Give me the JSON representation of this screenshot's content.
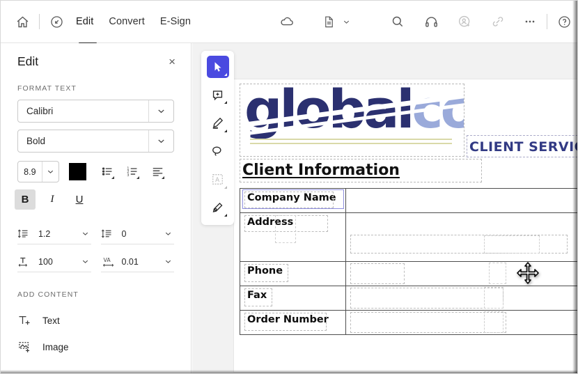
{
  "toolbar": {
    "home_icon": "home-icon",
    "pointer_circle_icon": "annotate-circle-icon",
    "menus": [
      {
        "label": "Edit",
        "active": true
      },
      {
        "label": "Convert",
        "active": false
      },
      {
        "label": "E-Sign",
        "active": false
      }
    ],
    "cloud_icon": "cloud-icon",
    "document_icon": "document-icon",
    "document_chevron_icon": "chevron-down-icon",
    "search_icon": "search-icon",
    "headphones_icon": "headphones-icon",
    "add_person_icon": "add-person-icon",
    "link_icon": "link-icon",
    "more_icon": "more-options-icon",
    "help_icon": "help-icon"
  },
  "panel": {
    "title": "Edit",
    "close_label": "×",
    "format_text_label": "FORMAT TEXT",
    "font_family": "Calibri",
    "font_style": "Bold",
    "font_size": "8.9",
    "font_color": "#000000",
    "bulleted_list_icon": "bulleted-list-icon",
    "numbered_list_icon": "numbered-list-icon",
    "align_icon": "text-align-icon",
    "bold_label": "B",
    "italic_label": "I",
    "underline_label": "U",
    "bold_active": true,
    "line_spacing": "1.2",
    "paragraph_spacing": "0",
    "horizontal_scale": "100",
    "character_spacing": "0.01",
    "char_spacing_icon_label": "VA",
    "add_content_label": "ADD CONTENT",
    "add_text_label": "Text",
    "add_image_label": "Image"
  },
  "rail": {
    "select_tool": "select-tool",
    "comment_tool": "add-comment-tool",
    "highlight_tool": "highlight-tool",
    "draw_tool": "draw-lasso-tool",
    "text_select_tool": "text-select-tool",
    "sign_tool": "sign-tool"
  },
  "document": {
    "logo_primary": "global",
    "logo_secondary": "corp",
    "client_service_text": "CLIENT SERVICE",
    "heading": "Client Information",
    "rows": [
      {
        "label": "Company Name",
        "value": "",
        "selected": true
      },
      {
        "label": "Address",
        "value": "",
        "selected": false
      },
      {
        "label": "Phone",
        "value": "",
        "selected": false
      },
      {
        "label": "Fax",
        "value": "",
        "selected": false
      },
      {
        "label": "Order Number",
        "value": "",
        "selected": false
      }
    ],
    "colors": {
      "logo_primary": "#2b3070",
      "logo_secondary": "#9aaada",
      "client_service": "#323a84",
      "accent_line": "#d9d9a8",
      "selection_border": "#8e8ede"
    }
  },
  "cursor": {
    "type": "move-cursor"
  }
}
